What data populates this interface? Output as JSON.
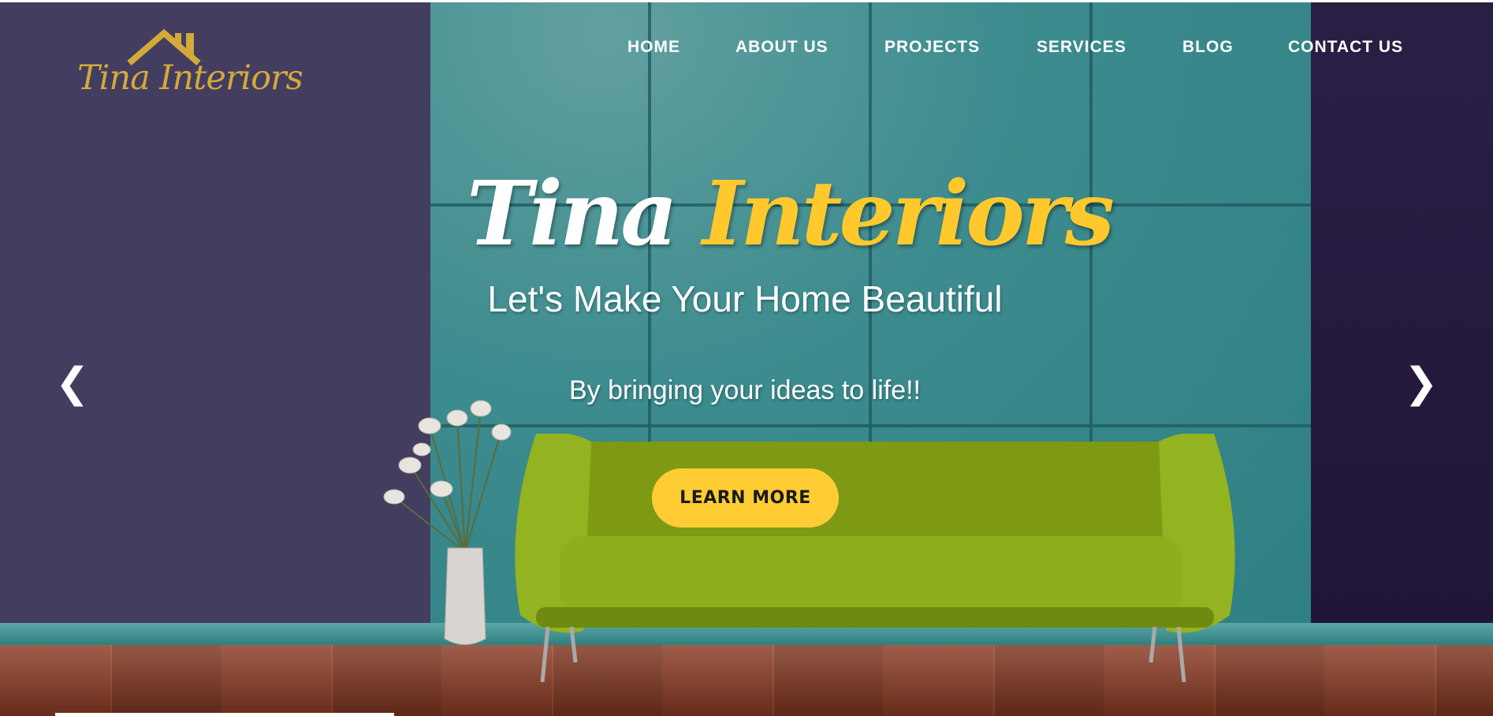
{
  "brand": {
    "logo_text": "Tina Interiors"
  },
  "nav": {
    "items": [
      {
        "label": "HOME"
      },
      {
        "label": "ABOUT US"
      },
      {
        "label": "PROJECTS"
      },
      {
        "label": "SERVICES"
      },
      {
        "label": "BLOG"
      },
      {
        "label": "CONTACT US"
      }
    ]
  },
  "hero": {
    "title_part1": "Tina",
    "title_part2": "Interiors",
    "subtitle": "Let's Make Your Home Beautiful",
    "tagline": "By bringing your ideas to life!!",
    "cta_label": "LEARN MORE",
    "prev_icon": "chevron-left-icon",
    "next_icon": "chevron-right-icon",
    "prev_glyph": "❮",
    "next_glyph": "❯"
  },
  "colors": {
    "accent": "#ffcd33",
    "logo": "#d3a93a",
    "wall_teal": "#3d8c8f",
    "wall_purple": "#433d60",
    "sofa_green": "#8aab1c"
  }
}
